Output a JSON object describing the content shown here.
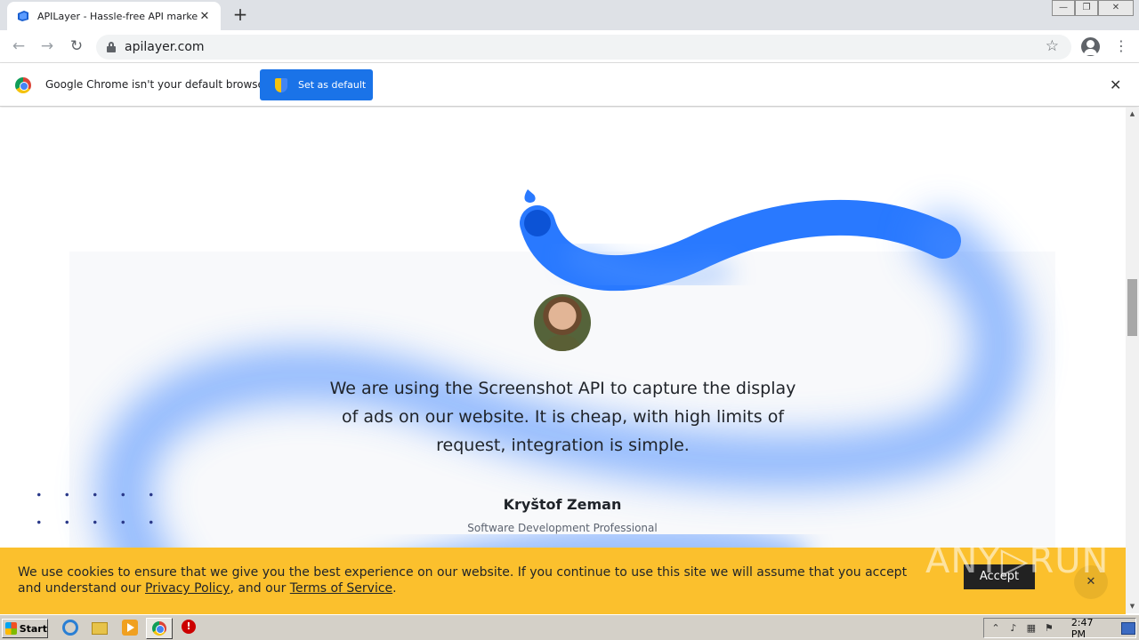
{
  "browser": {
    "tab_title": "APILayer - Hassle-free API marketpl",
    "new_tab_label": "+",
    "url": "apilayer.com",
    "window_controls": {
      "minimize": "—",
      "maximize": "❐",
      "close": "✕"
    },
    "icons": [
      "back-arrow-icon",
      "forward-arrow-icon",
      "reload-icon",
      "lock-icon",
      "star-icon",
      "profile-icon",
      "menu-icon"
    ]
  },
  "infobar": {
    "message": "Google Chrome isn't your default browser",
    "button_label": "Set as default",
    "close_label": "✕"
  },
  "testimonial": {
    "quote": "We are using the Screenshot API to capture the display of ads on our website. It is cheap, with high limits of request, integration is simple.",
    "author": "Kryštof Zeman",
    "role": "Software Development Professional"
  },
  "cookie_bar": {
    "text_before": "We use cookies to ensure that we give you the best experience on our website. If you continue to use this site we will assume that you accept and understand our ",
    "privacy_link": "Privacy Policy",
    "text_middle": ", and our ",
    "terms_link": "Terms of Service",
    "text_after": ".",
    "accept_label": "Accept",
    "close_label": "✕"
  },
  "watermark": "ANY▷RUN",
  "taskbar": {
    "start_label": "Start",
    "clock": "2:47 PM",
    "stop_icon_glyph": "!",
    "tray_up_glyph": "⌃",
    "volume_glyph": "♪",
    "flag_glyph": "⚑"
  },
  "colors": {
    "accent_blue": "#1a73e8",
    "ribbon_blue": "#2979ff",
    "cookie_yellow": "#fbc02d",
    "text_dark": "#1f2329"
  }
}
